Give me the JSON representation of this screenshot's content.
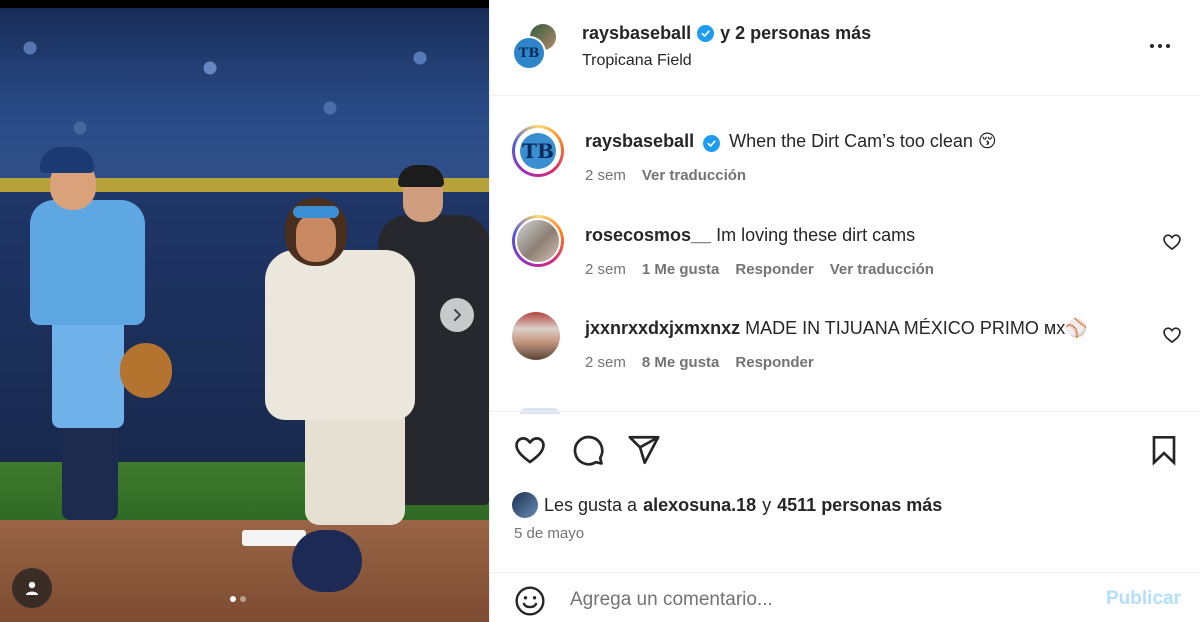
{
  "header": {
    "username": "raysbaseball",
    "collab_text": "y 2 personas más",
    "location": "Tropicana Field",
    "avatar_text": "TB"
  },
  "caption": {
    "username": "raysbaseball",
    "text": "When the Dirt Cam’s too clean 😚",
    "time": "2 sem",
    "translate": "Ver traducción",
    "avatar_text": "TB"
  },
  "comments": [
    {
      "username": "rosecosmos__",
      "text": "Im loving these dirt cams",
      "time": "2 sem",
      "likes": "1 Me gusta",
      "reply": "Responder",
      "translate": "Ver traducción"
    },
    {
      "username": "jxxnrxxdxjxmxnxz",
      "text": "MADE IN TIJUANA MÉXICO PRIMO ᴍx⚾",
      "time": "2 sem",
      "likes": "8 Me gusta",
      "reply": "Responder"
    }
  ],
  "likes": {
    "prefix": "Les gusta a",
    "user": "alexosuna.18",
    "conj": "y",
    "others": "4511 personas más"
  },
  "date": "5 de mayo",
  "comment_box": {
    "placeholder": "Agrega un comentario...",
    "publish": "Publicar"
  },
  "carousel": {
    "total": 2,
    "current": 1
  },
  "colors": {
    "verified": "#1d9bf0",
    "publish_disabled": "#b2dffc",
    "meta_gray": "#737373"
  },
  "icons": [
    "verified-icon",
    "more-options-icon",
    "heart-icon",
    "comment-icon",
    "share-icon",
    "save-icon",
    "emoji-icon",
    "next-arrow-icon",
    "user-tag-icon"
  ]
}
